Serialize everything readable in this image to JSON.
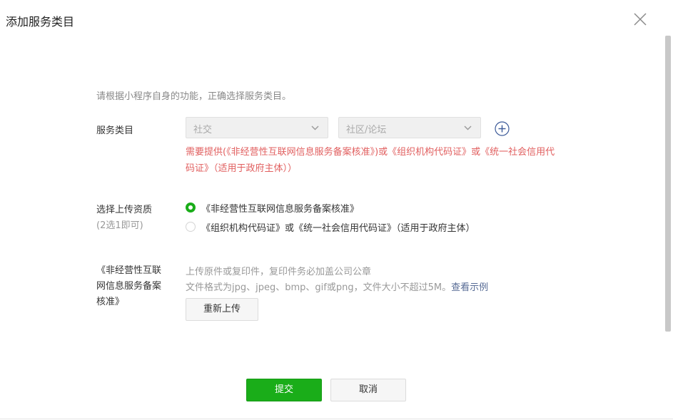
{
  "dialog": {
    "title": "添加服务类目"
  },
  "intro": "请根据小程序自身的功能，正确选择服务类目。",
  "category": {
    "label": "服务类目",
    "primary_value": "社交",
    "secondary_value": "社区/论坛",
    "requirement": "需要提供(《非经营性互联网信息服务备案核准》)或《组织机构代码证》或《统一社会信用代码证》（适用于政府主体））"
  },
  "qualification": {
    "label": "选择上传资质",
    "sub_label": "(2选1即可)",
    "options": [
      {
        "label": "《非经营性互联网信息服务备案核准》",
        "selected": true
      },
      {
        "label": "《组织机构代码证》或《统一社会信用代码证》（适用于政府主体）",
        "selected": false
      }
    ]
  },
  "upload": {
    "label": "《非经营性互联网信息服务备案核准》",
    "hint_line1": "上传原件或复印件，复印件务必加盖公司公章",
    "hint_line2": "文件格式为jpg、jpeg、bmp、gif或png，文件大小不超过5M。",
    "example_link": "查看示例",
    "reupload_button": "重新上传"
  },
  "footer": {
    "submit_button": "提交",
    "cancel_button": "取消"
  },
  "colors": {
    "primary_green": "#1aad19",
    "warning_red": "#e15f5f",
    "link_blue": "#576b95"
  }
}
